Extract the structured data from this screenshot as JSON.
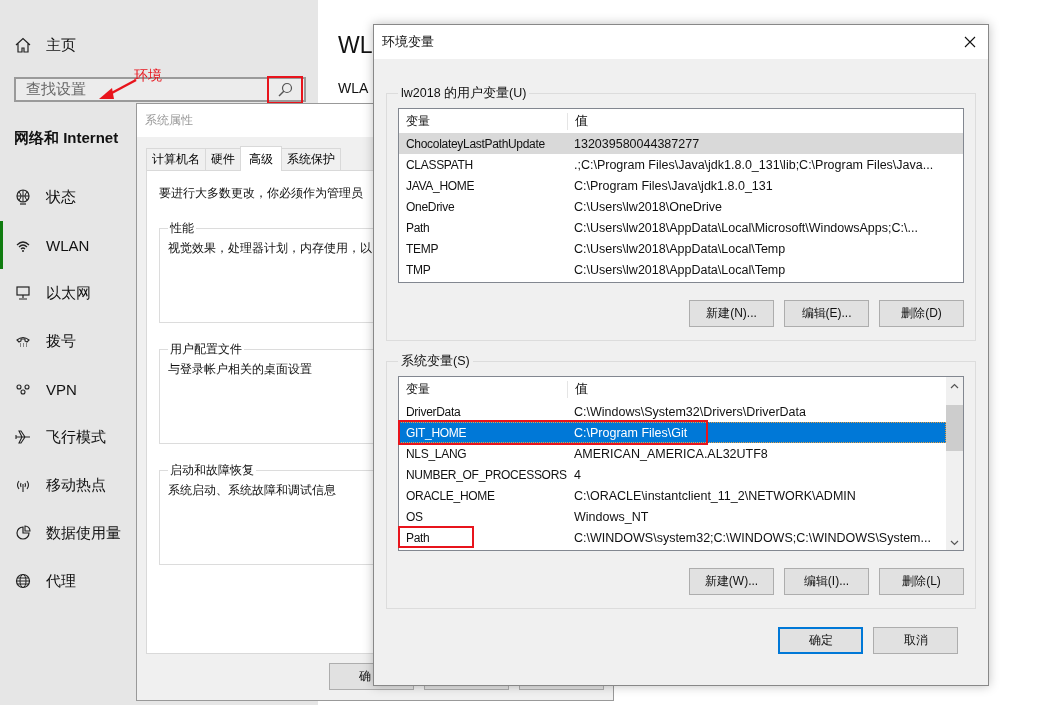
{
  "settings": {
    "home": "主页",
    "search": {
      "placeholder": "查找设置",
      "icon_marked": true,
      "callout": "环境"
    },
    "section_title": "网络和 Internet",
    "items": [
      {
        "label": "状态",
        "selected": false
      },
      {
        "label": "WLAN",
        "selected": true
      },
      {
        "label": "以太网",
        "selected": false
      },
      {
        "label": "拨号",
        "selected": false
      },
      {
        "label": "VPN",
        "selected": false
      },
      {
        "label": "飞行模式",
        "selected": false
      },
      {
        "label": "移动热点",
        "selected": false
      },
      {
        "label": "数据使用量",
        "selected": false
      },
      {
        "label": "代理",
        "selected": false
      }
    ],
    "page_title": "WL",
    "page_subtitle": "WLA"
  },
  "system_properties": {
    "title": "系统属性",
    "active": false,
    "tabs": [
      {
        "label": "计算机名",
        "selected": false
      },
      {
        "label": "硬件",
        "selected": false
      },
      {
        "label": "高级",
        "selected": true
      },
      {
        "label": "系统保护",
        "selected": false
      }
    ],
    "notice": "要进行大多数更改，你必须作为管理员",
    "groups": [
      {
        "title": "性能",
        "text": "视觉效果，处理器计划，内存使用，以"
      },
      {
        "title": "用户配置文件",
        "text": "与登录帐户相关的桌面设置"
      },
      {
        "title": "启动和故障恢复",
        "text": "系统启动、系统故障和调试信息"
      }
    ],
    "buttons": [
      "确"
    ]
  },
  "environment_variables": {
    "title": "环境变量",
    "active": true,
    "groups": [
      {
        "title": "lw2018 的用户变量(U)",
        "focused": false,
        "scrollable": false,
        "columns": [
          "变量",
          "值"
        ],
        "rows": [
          {
            "name": "ChocolateyLastPathUpdate",
            "value": "132039580044387277",
            "selected": true,
            "row_marked": false,
            "name_marked": false
          },
          {
            "name": "CLASSPATH",
            "value": ".;C:\\Program Files\\Java\\jdk1.8.0_131\\lib;C:\\Program Files\\Java...",
            "selected": false,
            "row_marked": false,
            "name_marked": false
          },
          {
            "name": "JAVA_HOME",
            "value": "C:\\Program Files\\Java\\jdk1.8.0_131",
            "selected": false,
            "row_marked": false,
            "name_marked": false
          },
          {
            "name": "OneDrive",
            "value": "C:\\Users\\lw2018\\OneDrive",
            "selected": false,
            "row_marked": false,
            "name_marked": false
          },
          {
            "name": "Path",
            "value": "C:\\Users\\lw2018\\AppData\\Local\\Microsoft\\WindowsApps;C:\\...",
            "selected": false,
            "row_marked": false,
            "name_marked": false
          },
          {
            "name": "TEMP",
            "value": "C:\\Users\\lw2018\\AppData\\Local\\Temp",
            "selected": false,
            "row_marked": false,
            "name_marked": false
          },
          {
            "name": "TMP",
            "value": "C:\\Users\\lw2018\\AppData\\Local\\Temp",
            "selected": false,
            "row_marked": false,
            "name_marked": false
          }
        ],
        "buttons": [
          "新建(N)...",
          "编辑(E)...",
          "删除(D)"
        ]
      },
      {
        "title": "系统变量(S)",
        "focused": true,
        "scrollable": true,
        "columns": [
          "变量",
          "值"
        ],
        "rows": [
          {
            "name": "DriverData",
            "value": "C:\\Windows\\System32\\Drivers\\DriverData",
            "selected": false,
            "row_marked": false,
            "name_marked": false
          },
          {
            "name": "GIT_HOME",
            "value": "C:\\Program Files\\Git",
            "selected": true,
            "row_marked": true,
            "name_marked": false
          },
          {
            "name": "NLS_LANG",
            "value": "AMERICAN_AMERICA.AL32UTF8",
            "selected": false,
            "row_marked": false,
            "name_marked": false
          },
          {
            "name": "NUMBER_OF_PROCESSORS",
            "value": "4",
            "selected": false,
            "row_marked": false,
            "name_marked": false
          },
          {
            "name": "ORACLE_HOME",
            "value": "C:\\ORACLE\\instantclient_11_2\\NETWORK\\ADMIN",
            "selected": false,
            "row_marked": false,
            "name_marked": false
          },
          {
            "name": "OS",
            "value": "Windows_NT",
            "selected": false,
            "row_marked": false,
            "name_marked": false
          },
          {
            "name": "Path",
            "value": "C:\\WINDOWS\\system32;C:\\WINDOWS;C:\\WINDOWS\\System...",
            "selected": false,
            "row_marked": false,
            "name_marked": true
          }
        ],
        "buttons": [
          "新建(W)...",
          "编辑(I)...",
          "删除(L)"
        ]
      }
    ],
    "ok": "确定",
    "cancel": "取消"
  }
}
